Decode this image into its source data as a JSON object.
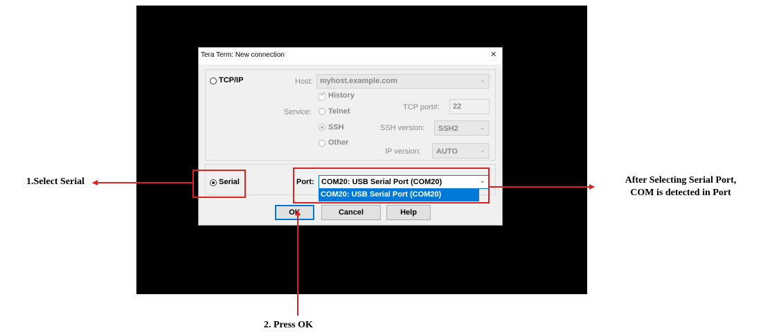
{
  "dialog": {
    "title": "Tera Term: New connection",
    "close": "×",
    "tcpip_label": "TCP/IP",
    "host_label": "Host:",
    "host_value": "myhost.example.com",
    "history_label": "History",
    "service_label": "Service:",
    "telnet_label": "Telnet",
    "ssh_label": "SSH",
    "other_label": "Other",
    "tcp_port_label": "TCP port#:",
    "tcp_port_value": "22",
    "ssh_version_label": "SSH version:",
    "ssh_version_value": "SSH2",
    "ip_version_label": "IP version:",
    "ip_version_value": "AUTO",
    "serial_label": "Serial",
    "port_label": "Port:",
    "port_value": "COM20: USB Serial Port (COM20)",
    "port_options": [
      "COM20: USB Serial Port (COM20)"
    ],
    "ok_label": "OK",
    "cancel_label": "Cancel",
    "help_label": "Help"
  },
  "annotations": {
    "step1": "1.Select Serial",
    "step2": "2. Press OK",
    "note_line1": "After Selecting Serial Port,",
    "note_line2": "COM is detected in Port",
    "color": "#e0201e"
  },
  "icons": {
    "dropdown": "chevron-down-icon",
    "close": "close-icon",
    "arrow": "arrow-icon"
  }
}
